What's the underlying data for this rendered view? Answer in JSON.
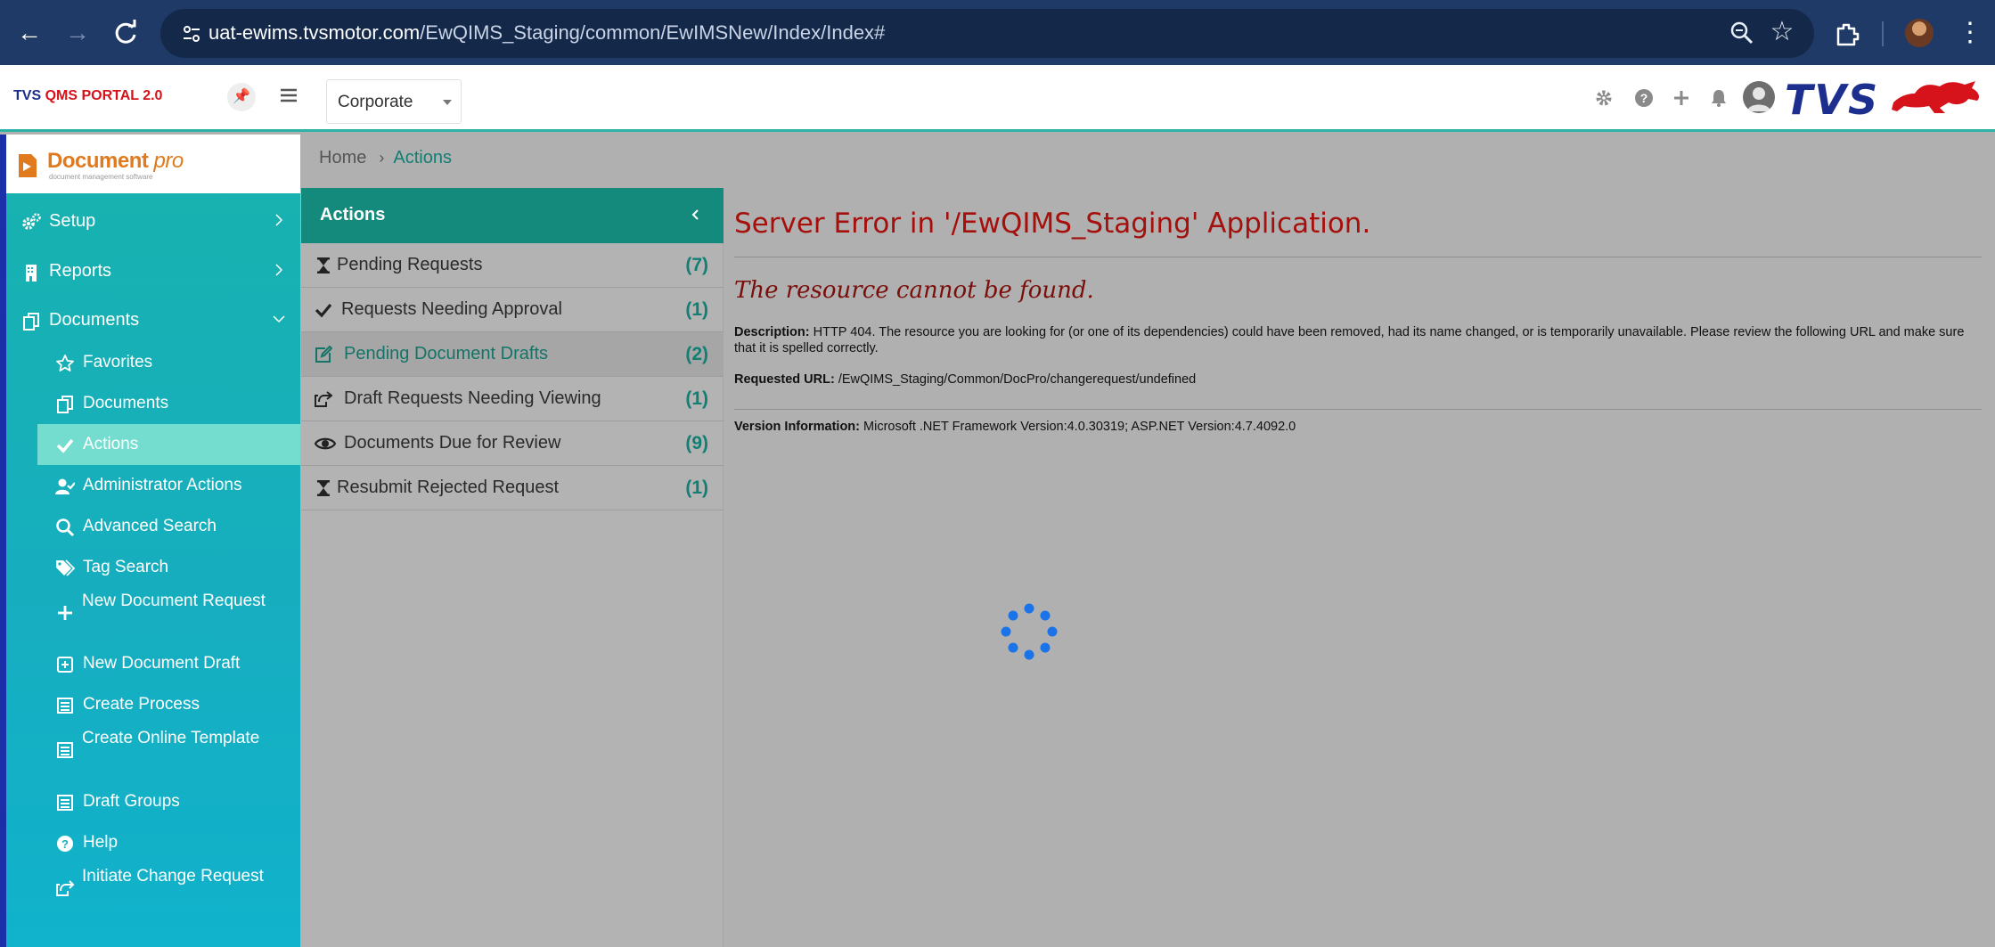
{
  "browser": {
    "url_host": "uat-ewims.tvsmotor.com",
    "url_path": "/EwQIMS_Staging/common/EwIMSNew/Index/Index#"
  },
  "header": {
    "brand_part1": "TVS ",
    "brand_part2": "QMS PORTAL 2.0",
    "location_select": "Corporate",
    "logo_text": "TVS"
  },
  "sidebar": {
    "logo_name": "Document",
    "logo_name_suffix": "pro",
    "logo_tagline": "document management software",
    "items": [
      {
        "label": "Setup",
        "icon": "gears-icon"
      },
      {
        "label": "Reports",
        "icon": "building-icon"
      },
      {
        "label": "Documents",
        "icon": "copy-icon"
      }
    ],
    "sub_items": [
      {
        "label": "Favorites",
        "icon": "star-icon"
      },
      {
        "label": "Documents",
        "icon": "copy-icon"
      },
      {
        "label": "Actions",
        "icon": "check-icon"
      },
      {
        "label": "Administrator Actions",
        "icon": "user-check-icon"
      },
      {
        "label": "Advanced Search",
        "icon": "search-icon"
      },
      {
        "label": "Tag Search",
        "icon": "tags-icon"
      },
      {
        "label": "New Document Request",
        "icon": "plus-icon"
      },
      {
        "label": "New Document Draft",
        "icon": "plus-square-icon"
      },
      {
        "label": "Create Process",
        "icon": "list-icon"
      },
      {
        "label": "Create Online Template",
        "icon": "list-icon"
      },
      {
        "label": "Draft Groups",
        "icon": "list-icon"
      },
      {
        "label": "Help",
        "icon": "question-icon"
      },
      {
        "label": "Initiate Change Request",
        "icon": "share-icon"
      }
    ]
  },
  "breadcrumb": {
    "home": "Home",
    "current": "Actions"
  },
  "actions": {
    "title": "Actions",
    "rows": [
      {
        "label": "Pending Requests",
        "count": "(7)",
        "icon": "hourglass-icon"
      },
      {
        "label": "Requests Needing Approval",
        "count": "(1)",
        "icon": "check-icon"
      },
      {
        "label": "Pending Document Drafts",
        "count": "(2)",
        "icon": "edit-icon"
      },
      {
        "label": "Draft Requests Needing Viewing",
        "count": "(1)",
        "icon": "share-icon"
      },
      {
        "label": "Documents Due for Review",
        "count": "(9)",
        "icon": "eye-icon"
      },
      {
        "label": "Resubmit Rejected Request",
        "count": "(1)",
        "icon": "hourglass-icon"
      }
    ]
  },
  "error": {
    "title": "Server Error in '/EwQIMS_Staging' Application.",
    "subtitle": "The resource cannot be found.",
    "description_label": "Description:",
    "description_text": "HTTP 404. The resource you are looking for (or one of its dependencies) could have been removed, had its name changed, or is temporarily unavailable.  Please review the following URL and make sure that it is spelled correctly.",
    "requested_url_label": "Requested URL:",
    "requested_url": "/EwQIMS_Staging/Common/DocPro/changerequest/undefined",
    "version_label": "Version Information:",
    "version_text": "Microsoft .NET Framework Version:4.0.30319; ASP.NET Version:4.7.4092.0"
  },
  "colors": {
    "chrome": "#1f3a66",
    "teal_header": "#148a7c",
    "sidebar": "#16aec0",
    "error_red": "#a5100c",
    "spinner": "#1a73e8"
  }
}
